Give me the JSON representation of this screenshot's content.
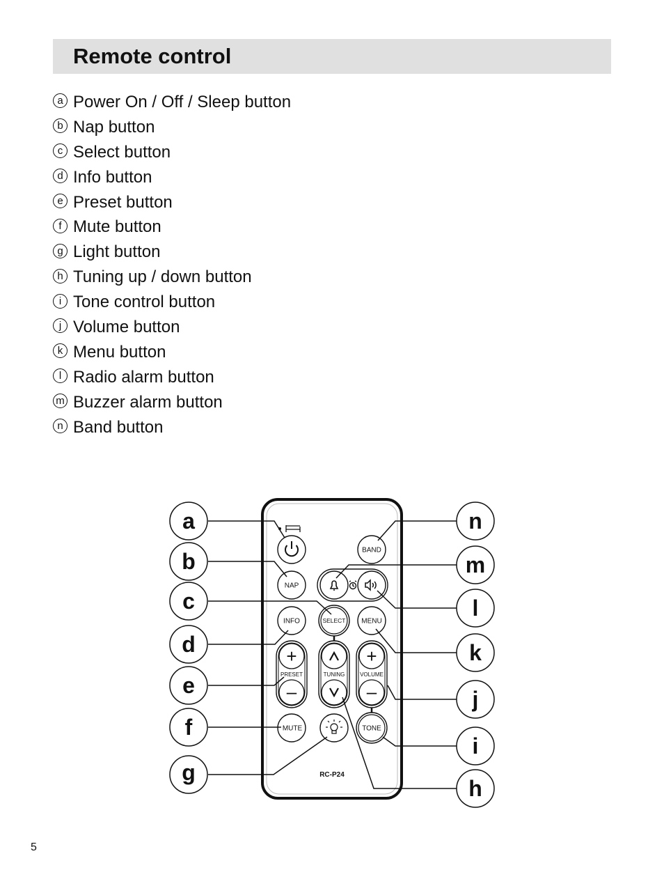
{
  "header": {
    "title": "Remote control"
  },
  "legend": [
    {
      "key": "a",
      "label": "Power On / Off / Sleep button"
    },
    {
      "key": "b",
      "label": "Nap button"
    },
    {
      "key": "c",
      "label": "Select button"
    },
    {
      "key": "d",
      "label": "Info button"
    },
    {
      "key": "e",
      "label": "Preset button"
    },
    {
      "key": "f",
      "label": "Mute button"
    },
    {
      "key": "g",
      "label": "Light button"
    },
    {
      "key": "h",
      "label": "Tuning up / down button"
    },
    {
      "key": "i",
      "label": "Tone control button"
    },
    {
      "key": "j",
      "label": "Volume button"
    },
    {
      "key": "k",
      "label": "Menu button"
    },
    {
      "key": "l",
      "label": "Radio alarm button"
    },
    {
      "key": "m",
      "label": "Buzzer alarm button"
    },
    {
      "key": "n",
      "label": "Band button"
    }
  ],
  "remote": {
    "model": "RC-P24",
    "buttons": {
      "band": "BAND",
      "nap": "NAP",
      "info": "INFO",
      "select": "SELECT",
      "menu": "MENU",
      "preset": "PRESET",
      "tuning": "TUNING",
      "volume": "VOLUME",
      "mute": "MUTE",
      "tone": "TONE",
      "plus": "+",
      "minus": "–"
    },
    "icons": {
      "power": "power-icon",
      "sleep": "bed-icon",
      "buzzer": "bell-icon",
      "alarm": "alarm-clock-icon",
      "radio": "speaker-icon",
      "light": "light-bulb-icon",
      "up": "chevron-up-icon",
      "down": "chevron-down-icon"
    }
  },
  "callouts": {
    "left": [
      "a",
      "b",
      "c",
      "d",
      "e",
      "f",
      "g"
    ],
    "right": [
      "n",
      "m",
      "l",
      "k",
      "j",
      "i",
      "h"
    ]
  },
  "page": {
    "number": "5"
  }
}
